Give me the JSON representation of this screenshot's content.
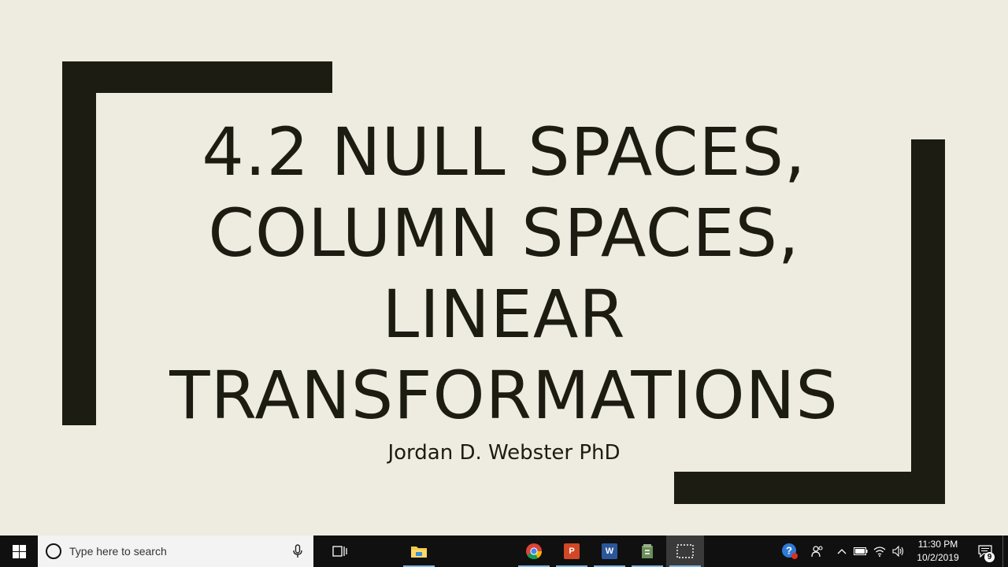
{
  "slide": {
    "title_lines": [
      "4.2 NULL SPACES,",
      "COLUMN SPACES,",
      "LINEAR",
      "TRANSFORMATIONS"
    ],
    "subtitle": "Jordan D. Webster PhD",
    "colors": {
      "background": "#EEEBE1",
      "bracket": "#1C1C12",
      "text": "#1C1C12"
    }
  },
  "taskbar": {
    "start_icon": "windows-logo-icon",
    "search_placeholder": "Type here to search",
    "apps": [
      {
        "name": "chrome",
        "icon": "chrome-icon"
      },
      {
        "name": "powerpoint",
        "icon": "powerpoint-icon",
        "glyph": "P"
      },
      {
        "name": "word",
        "icon": "word-icon",
        "glyph": "W"
      },
      {
        "name": "archive",
        "icon": "archive-icon"
      },
      {
        "name": "snipping",
        "icon": "snipping-tool-icon",
        "active": true
      }
    ],
    "clock": {
      "time": "11:30 PM",
      "date": "10/2/2019"
    },
    "notifications_count": "9"
  }
}
